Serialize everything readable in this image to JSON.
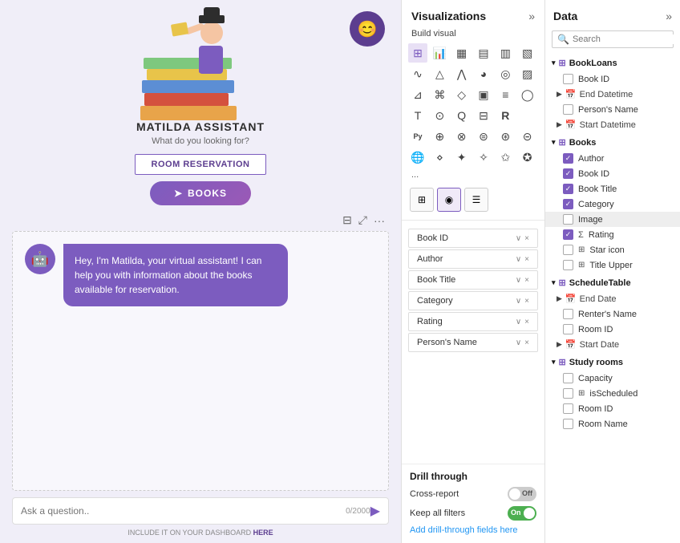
{
  "left": {
    "assistant_name": "MATILDA ASSISTANT",
    "assistant_subtitle": "What do you looking for?",
    "btn_room": "ROOM RESERVATION",
    "btn_books": "BOOKS",
    "chat_message": "Hey, I'm Matilda, your virtual assistant! I can help you with information about the books available for reservation.",
    "input_placeholder": "Ask a question..",
    "char_count": "0/2000",
    "dashboard_text": "INCLUDE IT ON YOUR DASHBOARD",
    "dashboard_link": "HERE",
    "avatar_icon": "👤"
  },
  "visualizations": {
    "title": "Visualizations",
    "build_label": "Build visual",
    "more_label": "...",
    "fields": [
      {
        "label": "Book ID"
      },
      {
        "label": "Author"
      },
      {
        "label": "Book Title"
      },
      {
        "label": "Category"
      },
      {
        "label": "Rating"
      },
      {
        "label": "Person's Name"
      }
    ],
    "drill": {
      "title": "Drill through",
      "cross_report": "Cross-report",
      "cross_value": "Off",
      "keep_filters": "Keep all filters",
      "keep_value": "On",
      "add_label": "Add drill-through fields here"
    }
  },
  "data": {
    "title": "Data",
    "search_placeholder": "Search",
    "sections": [
      {
        "name": "BookLoans",
        "icon": "📋",
        "items": [
          {
            "label": "Book ID",
            "checked": false,
            "type": "field"
          },
          {
            "label": "End Datetime",
            "checked": false,
            "type": "calendar",
            "expandable": true
          },
          {
            "label": "Person's Name",
            "checked": false,
            "type": "field"
          },
          {
            "label": "Start Datetime",
            "checked": false,
            "type": "calendar",
            "expandable": true
          }
        ]
      },
      {
        "name": "Books",
        "icon": "📋",
        "items": [
          {
            "label": "Author",
            "checked": true,
            "type": "field"
          },
          {
            "label": "Book ID",
            "checked": true,
            "type": "field"
          },
          {
            "label": "Book Title",
            "checked": true,
            "type": "field"
          },
          {
            "label": "Category",
            "checked": true,
            "type": "field"
          },
          {
            "label": "Image",
            "checked": false,
            "type": "field",
            "highlighted": true
          },
          {
            "label": "Rating",
            "checked": true,
            "type": "sigma"
          },
          {
            "label": "Star icon",
            "checked": false,
            "type": "table"
          },
          {
            "label": "Title Upper",
            "checked": false,
            "type": "table"
          }
        ]
      },
      {
        "name": "ScheduleTable",
        "icon": "📋",
        "items": [
          {
            "label": "End Date",
            "checked": false,
            "type": "calendar",
            "expandable": true
          },
          {
            "label": "Renter's Name",
            "checked": false,
            "type": "field"
          },
          {
            "label": "Room ID",
            "checked": false,
            "type": "field"
          },
          {
            "label": "Start Date",
            "checked": false,
            "type": "calendar",
            "expandable": true
          }
        ]
      },
      {
        "name": "Study rooms",
        "icon": "📋",
        "items": [
          {
            "label": "Capacity",
            "checked": false,
            "type": "field"
          },
          {
            "label": "isScheduled",
            "checked": false,
            "type": "table"
          },
          {
            "label": "Room ID",
            "checked": false,
            "type": "field"
          },
          {
            "label": "Room Name",
            "checked": false,
            "type": "field"
          }
        ]
      }
    ]
  },
  "colors": {
    "purple": "#7c5cbf",
    "light_purple": "#f0eef8",
    "green": "#4caf50"
  }
}
